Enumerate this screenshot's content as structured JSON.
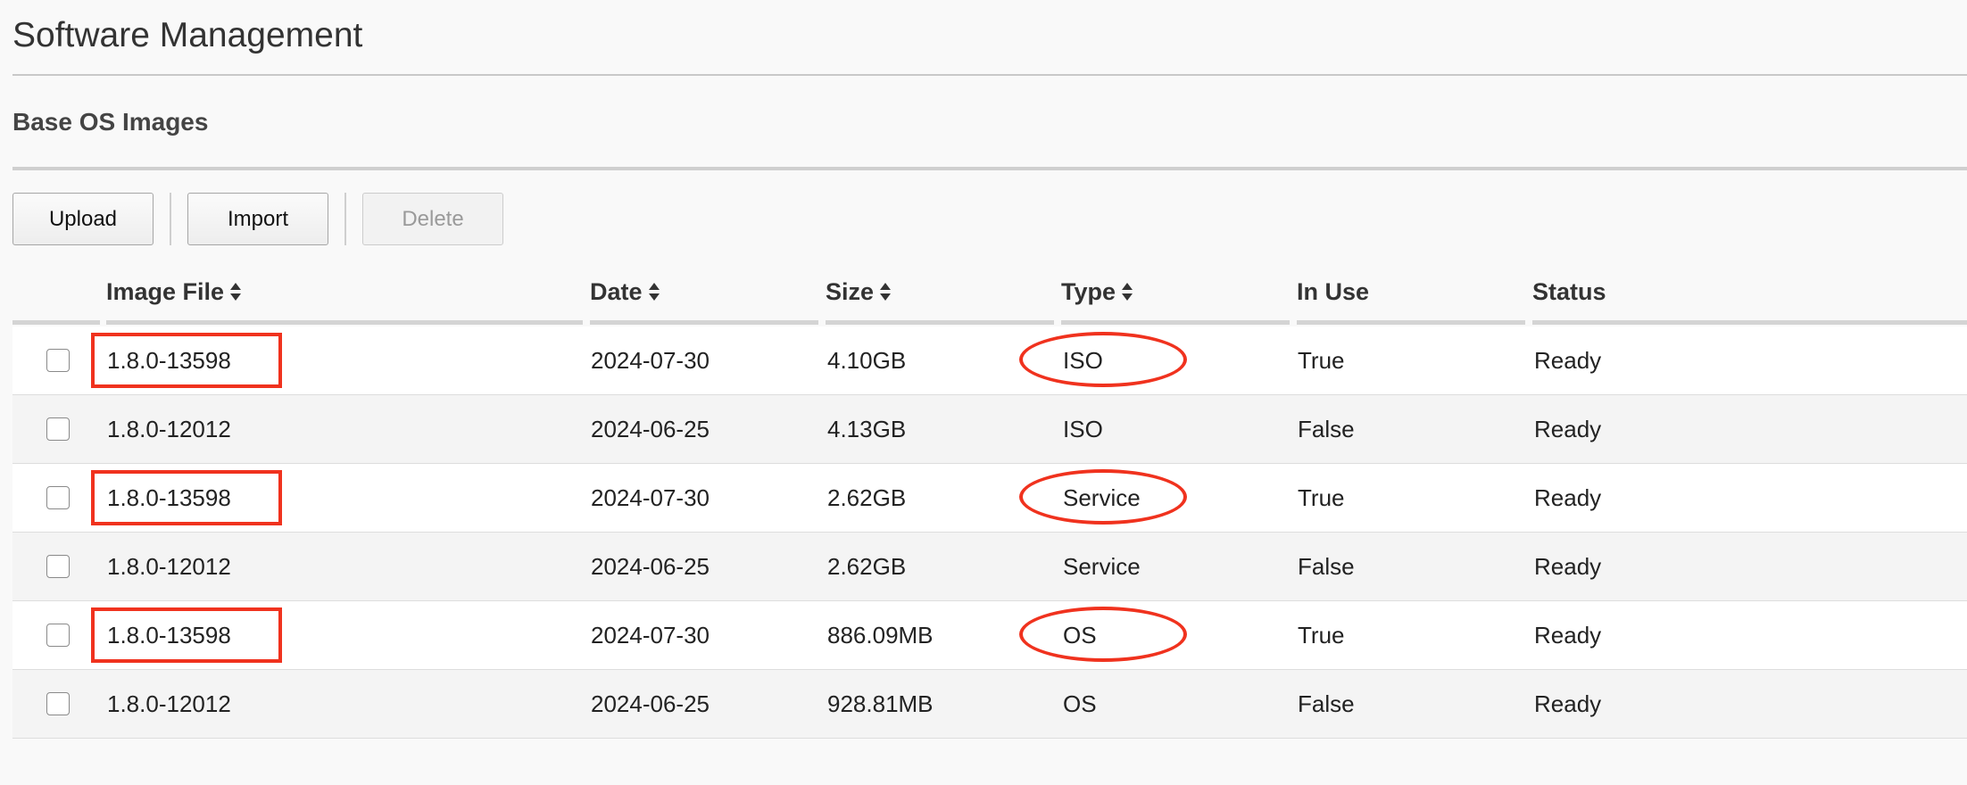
{
  "page": {
    "title": "Software Management"
  },
  "section": {
    "title": "Base OS Images"
  },
  "toolbar": {
    "upload_label": "Upload",
    "import_label": "Import",
    "delete_label": "Delete"
  },
  "table": {
    "columns": {
      "image_file": "Image File",
      "date": "Date",
      "size": "Size",
      "type": "Type",
      "in_use": "In Use",
      "status": "Status"
    },
    "rows": [
      {
        "image_file": "1.8.0-13598",
        "date": "2024-07-30",
        "size": "4.10GB",
        "type": "ISO",
        "in_use": "True",
        "status": "Ready",
        "highlighted": true
      },
      {
        "image_file": "1.8.0-12012",
        "date": "2024-06-25",
        "size": "4.13GB",
        "type": "ISO",
        "in_use": "False",
        "status": "Ready",
        "highlighted": false
      },
      {
        "image_file": "1.8.0-13598",
        "date": "2024-07-30",
        "size": "2.62GB",
        "type": "Service",
        "in_use": "True",
        "status": "Ready",
        "highlighted": true
      },
      {
        "image_file": "1.8.0-12012",
        "date": "2024-06-25",
        "size": "2.62GB",
        "type": "Service",
        "in_use": "False",
        "status": "Ready",
        "highlighted": false
      },
      {
        "image_file": "1.8.0-13598",
        "date": "2024-07-30",
        "size": "886.09MB",
        "type": "OS",
        "in_use": "True",
        "status": "Ready",
        "highlighted": true
      },
      {
        "image_file": "1.8.0-12012",
        "date": "2024-06-25",
        "size": "928.81MB",
        "type": "OS",
        "in_use": "False",
        "status": "Ready",
        "highlighted": false
      }
    ]
  },
  "colors": {
    "annotation": "#f0321e",
    "row_even": "#f4f4f4",
    "row_odd": "#ffffff"
  },
  "icons": {
    "sort": "sort-icon",
    "checkbox": "checkbox"
  }
}
